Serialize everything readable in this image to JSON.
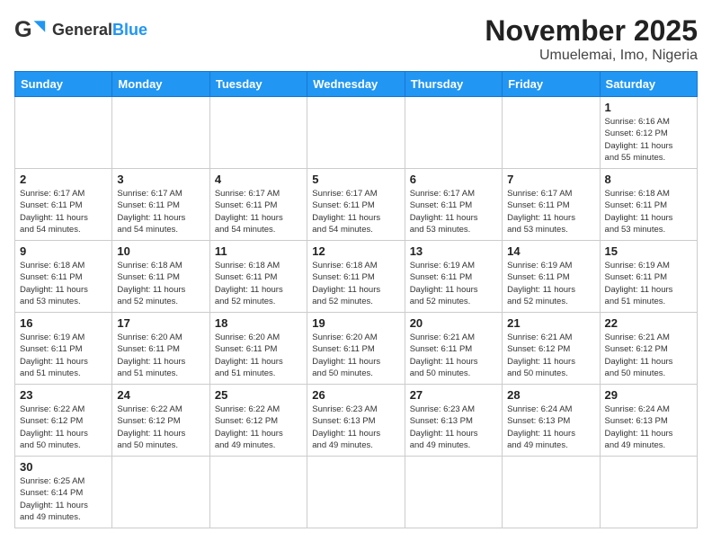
{
  "header": {
    "logo_text_general": "General",
    "logo_text_blue": "Blue",
    "title": "November 2025",
    "subtitle": "Umuelemai, Imo, Nigeria"
  },
  "weekdays": [
    "Sunday",
    "Monday",
    "Tuesday",
    "Wednesday",
    "Thursday",
    "Friday",
    "Saturday"
  ],
  "weeks": [
    [
      {
        "day": "",
        "info": ""
      },
      {
        "day": "",
        "info": ""
      },
      {
        "day": "",
        "info": ""
      },
      {
        "day": "",
        "info": ""
      },
      {
        "day": "",
        "info": ""
      },
      {
        "day": "",
        "info": ""
      },
      {
        "day": "1",
        "info": "Sunrise: 6:16 AM\nSunset: 6:12 PM\nDaylight: 11 hours\nand 55 minutes."
      }
    ],
    [
      {
        "day": "2",
        "info": "Sunrise: 6:17 AM\nSunset: 6:11 PM\nDaylight: 11 hours\nand 54 minutes."
      },
      {
        "day": "3",
        "info": "Sunrise: 6:17 AM\nSunset: 6:11 PM\nDaylight: 11 hours\nand 54 minutes."
      },
      {
        "day": "4",
        "info": "Sunrise: 6:17 AM\nSunset: 6:11 PM\nDaylight: 11 hours\nand 54 minutes."
      },
      {
        "day": "5",
        "info": "Sunrise: 6:17 AM\nSunset: 6:11 PM\nDaylight: 11 hours\nand 54 minutes."
      },
      {
        "day": "6",
        "info": "Sunrise: 6:17 AM\nSunset: 6:11 PM\nDaylight: 11 hours\nand 53 minutes."
      },
      {
        "day": "7",
        "info": "Sunrise: 6:17 AM\nSunset: 6:11 PM\nDaylight: 11 hours\nand 53 minutes."
      },
      {
        "day": "8",
        "info": "Sunrise: 6:18 AM\nSunset: 6:11 PM\nDaylight: 11 hours\nand 53 minutes."
      }
    ],
    [
      {
        "day": "9",
        "info": "Sunrise: 6:18 AM\nSunset: 6:11 PM\nDaylight: 11 hours\nand 53 minutes."
      },
      {
        "day": "10",
        "info": "Sunrise: 6:18 AM\nSunset: 6:11 PM\nDaylight: 11 hours\nand 52 minutes."
      },
      {
        "day": "11",
        "info": "Sunrise: 6:18 AM\nSunset: 6:11 PM\nDaylight: 11 hours\nand 52 minutes."
      },
      {
        "day": "12",
        "info": "Sunrise: 6:18 AM\nSunset: 6:11 PM\nDaylight: 11 hours\nand 52 minutes."
      },
      {
        "day": "13",
        "info": "Sunrise: 6:19 AM\nSunset: 6:11 PM\nDaylight: 11 hours\nand 52 minutes."
      },
      {
        "day": "14",
        "info": "Sunrise: 6:19 AM\nSunset: 6:11 PM\nDaylight: 11 hours\nand 52 minutes."
      },
      {
        "day": "15",
        "info": "Sunrise: 6:19 AM\nSunset: 6:11 PM\nDaylight: 11 hours\nand 51 minutes."
      }
    ],
    [
      {
        "day": "16",
        "info": "Sunrise: 6:19 AM\nSunset: 6:11 PM\nDaylight: 11 hours\nand 51 minutes."
      },
      {
        "day": "17",
        "info": "Sunrise: 6:20 AM\nSunset: 6:11 PM\nDaylight: 11 hours\nand 51 minutes."
      },
      {
        "day": "18",
        "info": "Sunrise: 6:20 AM\nSunset: 6:11 PM\nDaylight: 11 hours\nand 51 minutes."
      },
      {
        "day": "19",
        "info": "Sunrise: 6:20 AM\nSunset: 6:11 PM\nDaylight: 11 hours\nand 50 minutes."
      },
      {
        "day": "20",
        "info": "Sunrise: 6:21 AM\nSunset: 6:11 PM\nDaylight: 11 hours\nand 50 minutes."
      },
      {
        "day": "21",
        "info": "Sunrise: 6:21 AM\nSunset: 6:12 PM\nDaylight: 11 hours\nand 50 minutes."
      },
      {
        "day": "22",
        "info": "Sunrise: 6:21 AM\nSunset: 6:12 PM\nDaylight: 11 hours\nand 50 minutes."
      }
    ],
    [
      {
        "day": "23",
        "info": "Sunrise: 6:22 AM\nSunset: 6:12 PM\nDaylight: 11 hours\nand 50 minutes."
      },
      {
        "day": "24",
        "info": "Sunrise: 6:22 AM\nSunset: 6:12 PM\nDaylight: 11 hours\nand 50 minutes."
      },
      {
        "day": "25",
        "info": "Sunrise: 6:22 AM\nSunset: 6:12 PM\nDaylight: 11 hours\nand 49 minutes."
      },
      {
        "day": "26",
        "info": "Sunrise: 6:23 AM\nSunset: 6:13 PM\nDaylight: 11 hours\nand 49 minutes."
      },
      {
        "day": "27",
        "info": "Sunrise: 6:23 AM\nSunset: 6:13 PM\nDaylight: 11 hours\nand 49 minutes."
      },
      {
        "day": "28",
        "info": "Sunrise: 6:24 AM\nSunset: 6:13 PM\nDaylight: 11 hours\nand 49 minutes."
      },
      {
        "day": "29",
        "info": "Sunrise: 6:24 AM\nSunset: 6:13 PM\nDaylight: 11 hours\nand 49 minutes."
      }
    ],
    [
      {
        "day": "30",
        "info": "Sunrise: 6:25 AM\nSunset: 6:14 PM\nDaylight: 11 hours\nand 49 minutes."
      },
      {
        "day": "",
        "info": ""
      },
      {
        "day": "",
        "info": ""
      },
      {
        "day": "",
        "info": ""
      },
      {
        "day": "",
        "info": ""
      },
      {
        "day": "",
        "info": ""
      },
      {
        "day": "",
        "info": ""
      }
    ]
  ]
}
